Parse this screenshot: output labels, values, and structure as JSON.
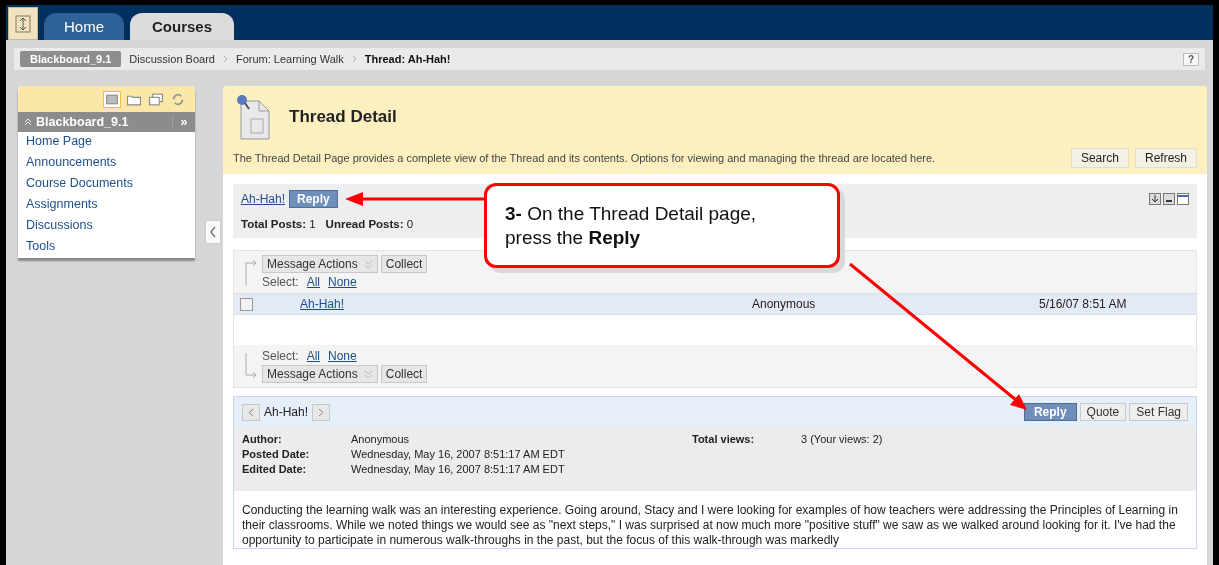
{
  "top_tabs": [
    {
      "label": "Home",
      "selected": false
    },
    {
      "label": "Courses",
      "selected": true
    }
  ],
  "breadcrumb": {
    "course": "Blackboard_9.1",
    "items": [
      {
        "label": "Discussion Board",
        "current": false
      },
      {
        "label": "Forum: Learning Walk",
        "current": false
      },
      {
        "label": "Thread: Ah-Hah!",
        "current": true
      }
    ],
    "help": "?"
  },
  "sidebar": {
    "view_modes": [
      {
        "kind": "list",
        "selected": true
      },
      {
        "kind": "folder",
        "selected": false
      },
      {
        "kind": "windows",
        "selected": false
      },
      {
        "kind": "refresh",
        "selected": false
      }
    ],
    "title": "Blackboard_9.1",
    "expand": "»",
    "items": [
      "Home Page",
      "Announcements",
      "Course Documents",
      "Assignments",
      "Discussions",
      "Tools"
    ]
  },
  "header": {
    "title": "Thread Detail",
    "description": "The Thread Detail Page provides a complete view of the Thread and its contents. Options for viewing and managing the thread are located here.",
    "buttons": [
      "Search",
      "Refresh"
    ]
  },
  "thread_bar": {
    "link": "Ah-Hah!",
    "reply": "Reply",
    "total_posts_label": "Total Posts:",
    "total_posts": "1",
    "unread_label": "Unread Posts:",
    "unread": "0"
  },
  "actions_top": {
    "message_actions": "Message Actions",
    "collect": "Collect",
    "select_label": "Select:",
    "all": "All",
    "none": "None"
  },
  "messages": [
    {
      "title": "Ah-Hah!",
      "author": "Anonymous",
      "date": "5/16/07 8:51 AM",
      "checked": false
    }
  ],
  "actions_bottom": {
    "message_actions": "Message Actions",
    "collect": "Collect",
    "select_label": "Select:",
    "all": "All",
    "none": "None"
  },
  "message_detail": {
    "title": "Ah-Hah!",
    "buttons": [
      {
        "label": "Reply",
        "primary": true
      },
      {
        "label": "Quote",
        "primary": false
      },
      {
        "label": "Set Flag",
        "primary": false
      }
    ],
    "fields": [
      {
        "label": "Author:",
        "value": "Anonymous"
      },
      {
        "label": "Posted Date:",
        "value": "Wednesday, May 16, 2007 8:51:17 AM EDT"
      },
      {
        "label": "Edited Date:",
        "value": "Wednesday, May 16, 2007 8:51:17 AM EDT"
      }
    ],
    "total_views_label": "Total views:",
    "total_views": "3 (Your views: 2)",
    "body": "Conducting the learning walk was an interesting experience. Going around, Stacy and I were looking for examples of how teachers were addressing the Principles of Learning in their classrooms. While we noted things we would see as \"next steps,\" I was surprised at now much more \"positive stuff\" we saw as we walked around looking for it. I've had the opportunity to participate in numerous walk-throughs in the past, but the focus of this walk-through was markedly"
  },
  "callout": {
    "text": "**3-** On the Thread Detail page, press the **Reply**"
  }
}
